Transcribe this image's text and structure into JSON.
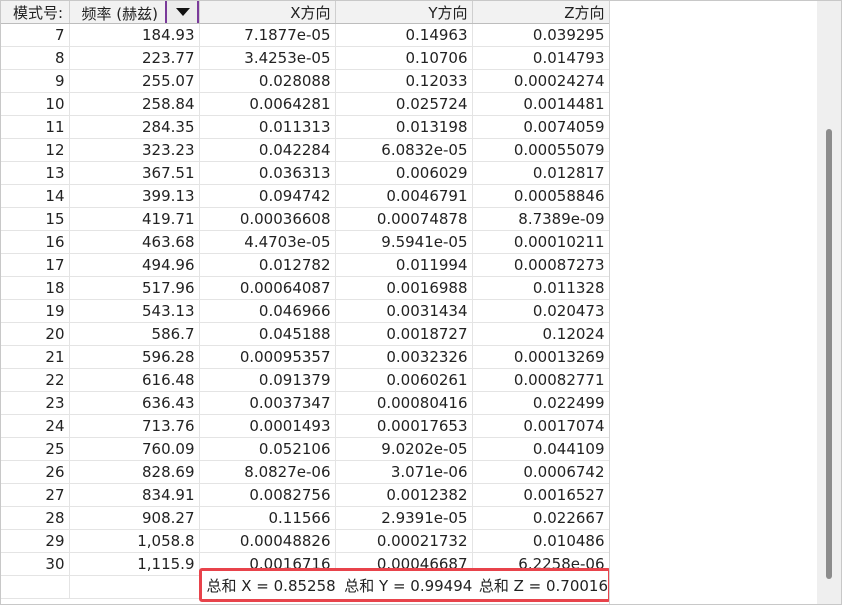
{
  "table": {
    "headers": {
      "mode": "模式号:",
      "frequency": "频率 (赫兹)",
      "x": "X方向",
      "y": "Y方向",
      "z": "Z方向"
    },
    "rows": [
      [
        "7",
        "184.93",
        "7.1877e-05",
        "0.14963",
        "0.039295"
      ],
      [
        "8",
        "223.77",
        "3.4253e-05",
        "0.10706",
        "0.014793"
      ],
      [
        "9",
        "255.07",
        "0.028088",
        "0.12033",
        "0.00024274"
      ],
      [
        "10",
        "258.84",
        "0.0064281",
        "0.025724",
        "0.0014481"
      ],
      [
        "11",
        "284.35",
        "0.011313",
        "0.013198",
        "0.0074059"
      ],
      [
        "12",
        "323.23",
        "0.042284",
        "6.0832e-05",
        "0.00055079"
      ],
      [
        "13",
        "367.51",
        "0.036313",
        "0.006029",
        "0.012817"
      ],
      [
        "14",
        "399.13",
        "0.094742",
        "0.0046791",
        "0.00058846"
      ],
      [
        "15",
        "419.71",
        "0.00036608",
        "0.00074878",
        "8.7389e-09"
      ],
      [
        "16",
        "463.68",
        "4.4703e-05",
        "9.5941e-05",
        "0.00010211"
      ],
      [
        "17",
        "494.96",
        "0.012782",
        "0.011994",
        "0.00087273"
      ],
      [
        "18",
        "517.96",
        "0.00064087",
        "0.0016988",
        "0.011328"
      ],
      [
        "19",
        "543.13",
        "0.046966",
        "0.0031434",
        "0.020473"
      ],
      [
        "20",
        "586.7",
        "0.045188",
        "0.0018727",
        "0.12024"
      ],
      [
        "21",
        "596.28",
        "0.00095357",
        "0.0032326",
        "0.00013269"
      ],
      [
        "22",
        "616.48",
        "0.091379",
        "0.0060261",
        "0.00082771"
      ],
      [
        "23",
        "636.43",
        "0.0037347",
        "0.00080416",
        "0.022499"
      ],
      [
        "24",
        "713.76",
        "0.0001493",
        "0.00017653",
        "0.0017074"
      ],
      [
        "25",
        "760.09",
        "0.052106",
        "9.0202e-05",
        "0.044109"
      ],
      [
        "26",
        "828.69",
        "8.0827e-06",
        "3.071e-06",
        "0.0006742"
      ],
      [
        "27",
        "834.91",
        "0.0082756",
        "0.0012382",
        "0.0016527"
      ],
      [
        "28",
        "908.27",
        "0.11566",
        "2.9391e-05",
        "0.022667"
      ],
      [
        "29",
        "1,058.8",
        "0.00048826",
        "0.00021732",
        "0.010486"
      ],
      [
        "30",
        "1,115.9",
        "0.0016716",
        "0.00046687",
        "6.2258e-06"
      ]
    ],
    "sums": {
      "x": "总和 X = 0.85258",
      "y": "总和 Y = 0.99494",
      "z": "总和 Z = 0.70016"
    }
  },
  "icons": {
    "sort": "sort-down-triangle-icon"
  },
  "colors": {
    "highlight_border": "#e8434b",
    "header_active_border": "#7a3a9a",
    "header_bg": "#f2f2f2"
  }
}
